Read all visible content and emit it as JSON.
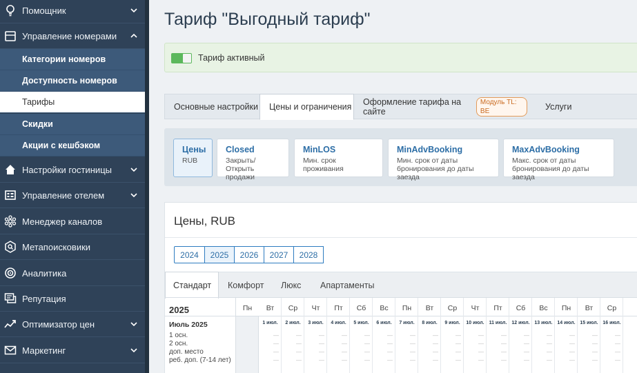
{
  "sidebar": {
    "items": [
      {
        "label": "Помощник",
        "icon": "lightbulb-icon",
        "chevron": "down"
      },
      {
        "label": "Управление номерами",
        "icon": "door-icon",
        "chevron": "up"
      }
    ],
    "sub_items": [
      {
        "label": "Категории номеров",
        "active": false
      },
      {
        "label": "Доступность номеров",
        "active": false
      },
      {
        "label": "Тарифы",
        "active": true
      },
      {
        "label": "Скидки",
        "active": false
      },
      {
        "label": "Акции с кешбэком",
        "active": false
      }
    ],
    "items_after": [
      {
        "label": "Настройки гостиницы",
        "icon": "home-icon",
        "chevron": "down"
      },
      {
        "label": "Управление отелем",
        "icon": "dashboard-icon",
        "chevron": "down"
      },
      {
        "label": "Менеджер каналов",
        "icon": "network-icon",
        "chevron": ""
      },
      {
        "label": "Метапоисковики",
        "icon": "search-shield-icon",
        "chevron": ""
      },
      {
        "label": "Аналитика",
        "icon": "target-icon",
        "chevron": ""
      },
      {
        "label": "Репутация",
        "icon": "chat-icon",
        "chevron": ""
      },
      {
        "label": "Оптимизатор цен",
        "icon": "trend-icon",
        "chevron": "down"
      },
      {
        "label": "Маркетинг",
        "icon": "mail-icon",
        "chevron": "down"
      }
    ]
  },
  "page": {
    "title": "Тариф \"Выгодный тариф\"",
    "status_text": "Тариф активный",
    "toggle_on": true
  },
  "tabs": [
    {
      "label": "Основные настройки",
      "active": false
    },
    {
      "label": "Цены и ограничения",
      "active": true
    },
    {
      "label": "Оформление тарифа на сайте",
      "badge": "Модуль TL: BE",
      "active": false
    },
    {
      "label": "Услуги",
      "active": false
    }
  ],
  "subtabs": [
    {
      "title": "Цены",
      "desc": "RUB",
      "active": true
    },
    {
      "title": "Closed",
      "desc": "Закрыть/Открыть продажи",
      "active": false
    },
    {
      "title": "MinLOS",
      "desc": "Мин. срок проживания",
      "active": false
    },
    {
      "title": "MinAdvBooking",
      "desc": "Мин. срок от даты бронирования до даты заезда",
      "active": false
    },
    {
      "title": "MaxAdvBooking",
      "desc": "Макс. срок от даты бронирования до даты заезда",
      "active": false
    }
  ],
  "prices": {
    "heading": "Цены, RUB",
    "years": [
      "2024",
      "2025",
      "2026",
      "2027",
      "2028"
    ],
    "selected_year": "2025",
    "room_tabs": [
      {
        "label": "Стандарт",
        "active": true
      },
      {
        "label": "Комфорт",
        "active": false
      },
      {
        "label": "Люкс",
        "active": false
      },
      {
        "label": "Апартаменты",
        "active": false
      }
    ],
    "grid": {
      "year": "2025",
      "month": "Июль 2025",
      "row_labels": [
        "1 осн.",
        "2 осн.",
        "доп. место",
        "реб. доп. (7-14 лет)"
      ],
      "first_weekday": "Пн",
      "days": [
        {
          "name": "Вт",
          "date": "1 июл."
        },
        {
          "name": "Ср",
          "date": "2 июл."
        },
        {
          "name": "Чт",
          "date": "3 июл."
        },
        {
          "name": "Пт",
          "date": "4 июл."
        },
        {
          "name": "Сб",
          "date": "5 июл."
        },
        {
          "name": "Вс",
          "date": "6 июл."
        },
        {
          "name": "Пн",
          "date": "7 июл."
        },
        {
          "name": "Вт",
          "date": "8 июл."
        },
        {
          "name": "Ср",
          "date": "9 июл."
        },
        {
          "name": "Чт",
          "date": "10 июл."
        },
        {
          "name": "Пт",
          "date": "11 июл."
        },
        {
          "name": "Сб",
          "date": "12 июл."
        },
        {
          "name": "Вс",
          "date": "13 июл."
        },
        {
          "name": "Пн",
          "date": "14 июл."
        },
        {
          "name": "Вт",
          "date": "15 июл."
        },
        {
          "name": "Ср",
          "date": "16 июл."
        }
      ],
      "empty_value": "—"
    }
  }
}
